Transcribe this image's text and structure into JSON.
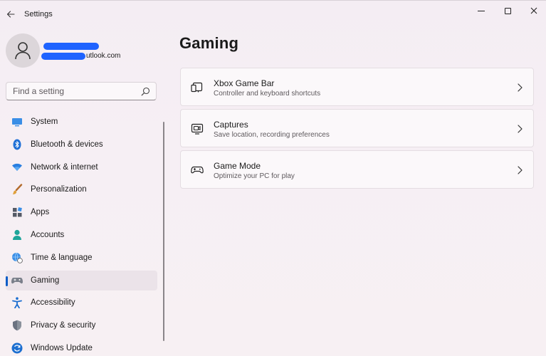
{
  "window": {
    "title": "Settings",
    "back_icon": "arrow-left-icon",
    "controls": [
      "minimize-icon",
      "maximize-icon",
      "close-icon"
    ]
  },
  "profile": {
    "email_visible": "utlook.com",
    "avatar_icon": "user-icon"
  },
  "search": {
    "placeholder": "Find a setting",
    "value": ""
  },
  "sidebar": {
    "items": [
      {
        "label": "System",
        "icon": "monitor-icon",
        "active": false
      },
      {
        "label": "Bluetooth & devices",
        "icon": "bluetooth-icon",
        "active": false
      },
      {
        "label": "Network & internet",
        "icon": "wifi-icon",
        "active": false
      },
      {
        "label": "Personalization",
        "icon": "brush-icon",
        "active": false
      },
      {
        "label": "Apps",
        "icon": "apps-icon",
        "active": false
      },
      {
        "label": "Accounts",
        "icon": "accounts-icon",
        "active": false
      },
      {
        "label": "Time & language",
        "icon": "globe-clock-icon",
        "active": false
      },
      {
        "label": "Gaming",
        "icon": "gamepad-icon",
        "active": true
      },
      {
        "label": "Accessibility",
        "icon": "accessibility-icon",
        "active": false
      },
      {
        "label": "Privacy & security",
        "icon": "shield-icon",
        "active": false
      },
      {
        "label": "Windows Update",
        "icon": "update-icon",
        "active": false
      }
    ]
  },
  "main": {
    "title": "Gaming",
    "cards": [
      {
        "title": "Xbox Game Bar",
        "subtitle": "Controller and keyboard shortcuts",
        "icon": "game-bar-icon"
      },
      {
        "title": "Captures",
        "subtitle": "Save location, recording preferences",
        "icon": "capture-icon"
      },
      {
        "title": "Game Mode",
        "subtitle": "Optimize your PC for play",
        "icon": "controller-icon"
      }
    ]
  },
  "colors": {
    "accent": "#0a5cc7",
    "background": "#f6eef3",
    "card": "#fbf8fa",
    "redaction": "#1f63ff"
  }
}
